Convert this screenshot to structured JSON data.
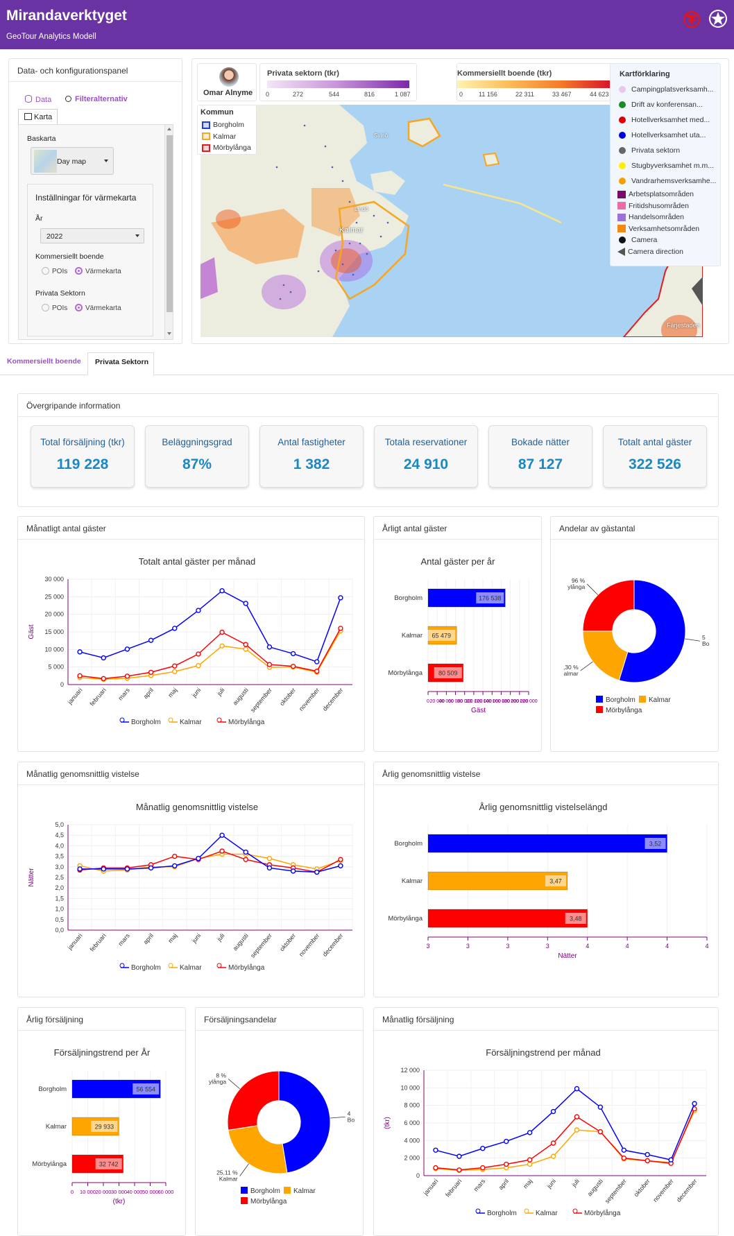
{
  "header": {
    "title": "Mirandaverktyget",
    "subtitle": "GeoTour Analytics Modell",
    "bg": "#6a33a3"
  },
  "panel": {
    "title": "Data- och konfigurationspanel",
    "tab_data": "Data",
    "tab_filter": "Filteralternativ",
    "tab_map": "Karta",
    "basemap_label": "Baskarta",
    "basemap_value": "Day map",
    "heatmap_settings": "Inställningar för värmekarta",
    "year_label": "År",
    "year_value": "2022",
    "kommersiellt_label": "Kommersiellt boende",
    "privata_label": "Privata Sektorn",
    "opt_pois": "POIs",
    "opt_heat": "Värmekarta"
  },
  "map": {
    "user_name": "Omar Alnyme",
    "privata_title": "Privata sektorn (tkr)",
    "privata_ticks": [
      "0",
      "272",
      "544",
      "816",
      "1 087"
    ],
    "kommersiellt_title": "Kommersiellt boende (tkr)",
    "kommersiellt_ticks": [
      "0",
      "11 156",
      "22 311",
      "33 467",
      "44 623"
    ],
    "kommun_title": "Kommun",
    "kommun_items": [
      {
        "label": "Borgholm",
        "color": "#1f3fd1"
      },
      {
        "label": "Kalmar",
        "color": "#f5a623"
      },
      {
        "label": "Mörbylånga",
        "color": "#e41a1c"
      }
    ],
    "legend_title": "Kartförklaring",
    "legend_items": [
      {
        "label": "Campingplatsverksamh...",
        "color": "#e8c8ec",
        "shape": "dot"
      },
      {
        "label": "Drift av konferensan...",
        "color": "#1b8a2a",
        "shape": "dot"
      },
      {
        "label": "Hotellverksamhet med...",
        "color": "#e00000",
        "shape": "dot"
      },
      {
        "label": "Hotellverksamhet uta...",
        "color": "#0000e0",
        "shape": "dot"
      },
      {
        "label": "Privata sektorn",
        "color": "#666666",
        "shape": "dot"
      },
      {
        "label": "Stugbyverksamhet m.m...",
        "color": "#ffee00",
        "shape": "dot"
      },
      {
        "label": "Vandrarhemsverksamhe...",
        "color": "#f5a000",
        "shape": "dot"
      },
      {
        "label": "Arbetsplatsområden",
        "color": "#7a0a6e",
        "shape": "sq"
      },
      {
        "label": "Fritidshusområden",
        "color": "#ee6aa8",
        "shape": "sq"
      },
      {
        "label": "Handelsområden",
        "color": "#9b72d8",
        "shape": "sq"
      },
      {
        "label": "Verksamhetsområden",
        "color": "#f08a10",
        "shape": "sq"
      },
      {
        "label": "Camera",
        "color": "#111111",
        "shape": "dot"
      },
      {
        "label": "Camera direction",
        "color": "#555555",
        "shape": "tri"
      }
    ],
    "place_labels": [
      "Svinö",
      "Kalmar",
      "Färjestaden",
      "Lindö"
    ]
  },
  "tabs": {
    "tab1": "Kommersiellt boende",
    "tab2": "Privata Sektorn"
  },
  "overview": {
    "title": "Övergripande information",
    "kpis": [
      {
        "label": "Total försäljning (tkr)",
        "value": "119 228"
      },
      {
        "label": "Beläggningsgrad",
        "value": "87%"
      },
      {
        "label": "Antal fastigheter",
        "value": "1 382"
      },
      {
        "label": "Totala reservationer",
        "value": "24 910"
      },
      {
        "label": "Bokade nätter",
        "value": "87 127"
      },
      {
        "label": "Totalt antal gäster",
        "value": "322 526"
      }
    ]
  },
  "cards": {
    "monthly_guests": "Månatligt antal gäster",
    "yearly_guests": "Årligt antal gäster",
    "guest_share": "Andelar av gästantal",
    "monthly_stay": "Månatlig genomsnittlig vistelse",
    "yearly_stay": "Årlig genomsnittlig vistelse",
    "yearly_sales": "Årlig försäljning",
    "sales_share": "Försäljningsandelar",
    "monthly_sales": "Månatlig försäljning"
  },
  "colors": {
    "Borgholm": "#0000ff",
    "Kalmar": "#ffa500",
    "Mörbylånga": "#ff0000"
  },
  "chart_data": [
    {
      "id": "monthly_guests",
      "type": "line",
      "title": "Totalt antal gäster per månad",
      "ylabel": "Gäst",
      "ylim": [
        0,
        30000
      ],
      "yticks": [
        "0",
        "5 000",
        "10 000",
        "15 000",
        "20 000",
        "25 000",
        "30 000"
      ],
      "categories": [
        "januari",
        "februari",
        "mars",
        "april",
        "maj",
        "juni",
        "juli",
        "augusti",
        "september",
        "oktober",
        "november",
        "december"
      ],
      "series": [
        {
          "name": "Borgholm",
          "values": [
            9300,
            7600,
            10100,
            12600,
            16000,
            21100,
            26700,
            23100,
            10700,
            8800,
            6500,
            24700
          ]
        },
        {
          "name": "Kalmar",
          "values": [
            2000,
            1500,
            1800,
            2600,
            3700,
            5400,
            11000,
            10100,
            4900,
            5000,
            3500,
            15300
          ]
        },
        {
          "name": "Mörbylånga",
          "values": [
            2500,
            1700,
            2400,
            3500,
            5300,
            8700,
            14900,
            11400,
            5700,
            5200,
            3800,
            16000
          ]
        }
      ],
      "legend": "bottom"
    },
    {
      "id": "yearly_guests",
      "type": "bar",
      "title": "Antal gäster per år",
      "xlabel": "Gäst",
      "categories": [
        "Borgholm",
        "Kalmar",
        "Mörbylånga"
      ],
      "values": [
        176538,
        65479,
        80509
      ],
      "labels": [
        "176 538",
        "65 479",
        "80 509"
      ],
      "xlim": [
        0,
        230000
      ],
      "xticks": [
        "0",
        "20 000",
        "40 000",
        "60 000",
        "80 000",
        "100 000",
        "120 000",
        "140 000",
        "160 000",
        "180 000",
        "200 000",
        "220 000"
      ]
    },
    {
      "id": "guest_share",
      "type": "pie",
      "categories": [
        "Borgholm",
        "Kalmar",
        "Mörbylånga"
      ],
      "values": [
        54.74,
        20.3,
        24.96
      ],
      "outer_labels": [
        [
          "5",
          "Bo"
        ],
        [
          ",30 %",
          "almar"
        ],
        [
          "96 %",
          "ylånga"
        ]
      ]
    },
    {
      "id": "monthly_stay",
      "type": "line",
      "title": "Månatlig genomsnittlig vistelse",
      "ylabel": "Nätter",
      "ylim": [
        0,
        5
      ],
      "yticks": [
        "0,0",
        "0,5",
        "1,0",
        "1,5",
        "2,0",
        "2,5",
        "3,0",
        "3,5",
        "4,0",
        "4,5",
        "5,0"
      ],
      "categories": [
        "januari",
        "februari",
        "mars",
        "april",
        "maj",
        "juni",
        "juli",
        "augusti",
        "september",
        "oktober",
        "november",
        "december"
      ],
      "series": [
        {
          "name": "Borgholm",
          "values": [
            2.9,
            2.9,
            2.9,
            2.95,
            3.05,
            3.4,
            4.5,
            3.7,
            2.95,
            2.8,
            2.75,
            3.05
          ]
        },
        {
          "name": "Kalmar",
          "values": [
            3.05,
            2.8,
            2.85,
            3.0,
            3.0,
            3.4,
            3.6,
            3.6,
            3.4,
            3.1,
            2.9,
            3.3
          ]
        },
        {
          "name": "Mörbylånga",
          "values": [
            2.85,
            2.95,
            2.95,
            3.1,
            3.5,
            3.35,
            3.75,
            3.35,
            3.1,
            2.95,
            2.75,
            3.35
          ]
        }
      ],
      "legend": "bottom"
    },
    {
      "id": "yearly_stay",
      "type": "bar",
      "title": "Årlig genomsnittlig vistelselängd",
      "xlabel": "Nätter",
      "categories": [
        "Borgholm",
        "Kalmar",
        "Mörbylånga"
      ],
      "values": [
        3.52,
        3.47,
        3.48
      ],
      "labels": [
        "3,52",
        "3,47",
        "3,48"
      ],
      "xlim": [
        3.4,
        3.54
      ],
      "xticks": [
        "3",
        "3",
        "3",
        "3",
        "4",
        "4",
        "4",
        "4"
      ]
    },
    {
      "id": "yearly_sales",
      "type": "bar",
      "title": "Försäljningstrend per År",
      "xlabel": "(tkr)",
      "categories": [
        "Borgholm",
        "Kalmar",
        "Mörbylånga"
      ],
      "values": [
        56554,
        29933,
        32742
      ],
      "labels": [
        "56 554",
        "29 933",
        "32 742"
      ],
      "xlim": [
        0,
        60000
      ],
      "xticks": [
        "0",
        "10 000",
        "20 000",
        "30 000",
        "40 000",
        "50 000",
        "60 000"
      ]
    },
    {
      "id": "sales_share",
      "type": "pie",
      "categories": [
        "Borgholm",
        "Kalmar",
        "Mörbylånga"
      ],
      "values": [
        47.43,
        25.11,
        27.46
      ],
      "outer_labels": [
        [
          "4",
          "Bo"
        ],
        [
          "25,11 %",
          "Kalmar"
        ],
        [
          "8 %",
          "ylånga"
        ]
      ]
    },
    {
      "id": "monthly_sales",
      "type": "line",
      "title": "Försäljningstrend per månad",
      "ylabel": "(tkr)",
      "ylim": [
        0,
        12000
      ],
      "yticks": [
        "0",
        "2 000",
        "4 000",
        "6 000",
        "8 000",
        "10 000",
        "12 000"
      ],
      "categories": [
        "januari",
        "februari",
        "mars",
        "april",
        "maj",
        "juni",
        "juli",
        "augusti",
        "september",
        "oktober",
        "november",
        "december"
      ],
      "series": [
        {
          "name": "Borgholm",
          "values": [
            2900,
            2200,
            3100,
            3900,
            4900,
            7300,
            9900,
            7800,
            2900,
            2400,
            1800,
            8200
          ]
        },
        {
          "name": "Kalmar",
          "values": [
            800,
            600,
            700,
            900,
            1300,
            2200,
            5200,
            5000,
            1900,
            1700,
            1500,
            7400
          ]
        },
        {
          "name": "Mörbylånga",
          "values": [
            900,
            650,
            900,
            1300,
            1800,
            3700,
            6700,
            5000,
            2000,
            1700,
            1400,
            7600
          ]
        }
      ],
      "legend": "bottom"
    }
  ]
}
